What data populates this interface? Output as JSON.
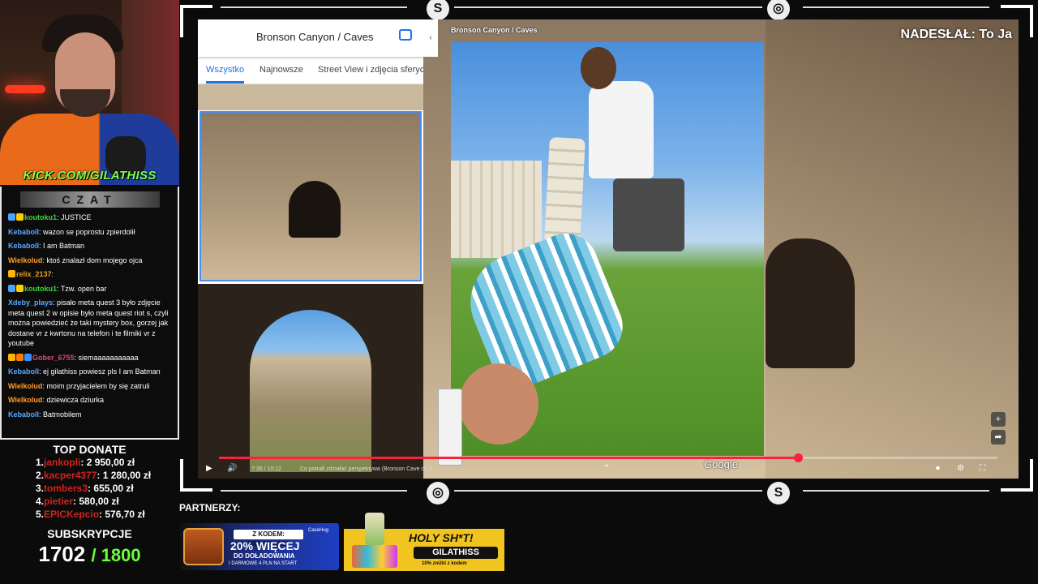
{
  "stream": {
    "kick_url": "KICK.COM/GILATHISS",
    "chat_title": "CZAT",
    "chat": [
      {
        "user": "koutoku1",
        "text": "JUSTICE",
        "user_color": "#3fd43f",
        "badges": [
          "#4aa3ff",
          "#ffcc00"
        ]
      },
      {
        "user": "Kebaboll",
        "text": "wazon se poprostu zpierdolił",
        "user_color": "#5aa8ff",
        "badges": []
      },
      {
        "user": "Kebaboll",
        "text": "I am Batman",
        "user_color": "#5aa8ff",
        "badges": []
      },
      {
        "user": "Wielkolud",
        "text": "ktoś znalazł dom mojego ojca",
        "user_color": "#ff9c2a",
        "badges": []
      },
      {
        "user": "relix_2137",
        "text": "",
        "user_color": "#e6a020",
        "badges": [
          "#ffb400"
        ]
      },
      {
        "user": "koutoku1",
        "text": "Tzw. open bar",
        "user_color": "#3fd43f",
        "badges": [
          "#4aa3ff",
          "#ffcc00"
        ]
      },
      {
        "user": "Xdeby_plays",
        "text": "pisało meta quest 3 było zdjęcie meta quest 2 w opisie było meta quest riot s, czyli można powiedzieć że taki mystery box, gorzej jak dostane vr z kwrtonu na telefon i te filmiki vr z youtube",
        "user_color": "#5aa8ff",
        "badges": []
      },
      {
        "user": "Gober_6755",
        "text": "siemaaaaaaaaaaa",
        "user_color": "#e0457b",
        "badges": [
          "#ffb400",
          "#ff7a00",
          "#3a8fff"
        ]
      },
      {
        "user": "Kebaboll",
        "text": "ej gilathiss powiesz pls I am Batman",
        "user_color": "#5aa8ff",
        "badges": []
      },
      {
        "user": "Wielkolud",
        "text": "moim przyjacielem by się zatruli",
        "user_color": "#ff9c2a",
        "badges": []
      },
      {
        "user": "Wielkolud",
        "text": "dziewicza dziurka",
        "user_color": "#ff9c2a",
        "badges": []
      },
      {
        "user": "Kebaboll",
        "text": "Batmobilem",
        "user_color": "#5aa8ff",
        "badges": []
      }
    ],
    "top_donate_title": "TOP DONATE",
    "donations": [
      {
        "rank": "1.",
        "name": "jankopli",
        "amount": "2 950,00 zł"
      },
      {
        "rank": "2.",
        "name": "kacper4377",
        "amount": "1 280,00 zł"
      },
      {
        "rank": "3.",
        "name": "tombers3",
        "amount": "655,00 zł"
      },
      {
        "rank": "4.",
        "name": "pietier",
        "amount": "580,00 zł"
      },
      {
        "rank": "5.",
        "name": "EPICKepcio",
        "amount": "576,70 zł"
      }
    ],
    "subs_title": "SUBSKRYPCJE",
    "subs_current": "1702",
    "subs_goal": "/ 1800",
    "partners_title": "PARTNERZY:"
  },
  "video": {
    "sender": "NADESŁAŁ: To Ja",
    "maps": {
      "search_text": "Bronson Canyon / Caves",
      "tabs": [
        "Wszystko",
        "Najnowsze",
        "Street View i zdjęcia sferyczne"
      ],
      "collapse_icon": "‹"
    },
    "yt_overlay_title": "Bronson Canyon / Caves",
    "google_watermark": "Google",
    "player": {
      "time": "7:35 / 10:12",
      "title": "Co potrafi zdziałać perspektywa (Bronson Cave cz..)",
      "progress": 0.744
    }
  },
  "ads": {
    "ad1": {
      "code": "Z KODEM: \"GILATHISS\"",
      "big": "20% WIĘCEJ",
      "line1": "DO DOŁADOWANIA",
      "line2": "I DARMOWE 4 PLN NA START",
      "brand": "CaseHug"
    },
    "ad2": {
      "title": "HOLY SH*T!",
      "code": "GILATHISS",
      "disc": "10% zniżki z kodem"
    }
  }
}
